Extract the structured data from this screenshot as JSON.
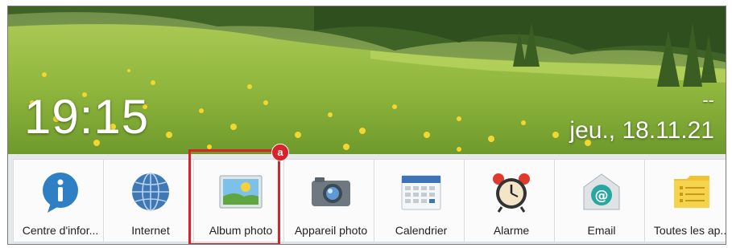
{
  "lockscreen": {
    "time": "19:15",
    "status_dash": "--",
    "date": "jeu., 18.11.21"
  },
  "apps": [
    {
      "label": "Centre d'infor...",
      "icon": "info-icon"
    },
    {
      "label": "Internet",
      "icon": "globe-icon"
    },
    {
      "label": "Album photo",
      "icon": "photo-album-icon"
    },
    {
      "label": "Appareil photo",
      "icon": "camera-icon"
    },
    {
      "label": "Calendrier",
      "icon": "calendar-icon"
    },
    {
      "label": "Alarme",
      "icon": "alarm-clock-icon"
    },
    {
      "label": "Email",
      "icon": "email-icon"
    },
    {
      "label": "Toutes les ap...",
      "icon": "all-apps-icon"
    }
  ],
  "annotation": {
    "badge_label": "a",
    "highlight_color": "#d8232a"
  }
}
